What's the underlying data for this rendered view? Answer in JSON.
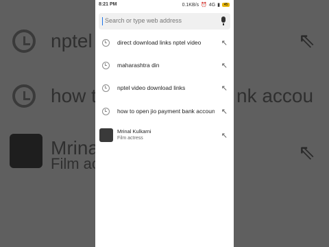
{
  "background": {
    "items": [
      "nptel vi",
      "how to",
      "nk accou",
      "Mrinal K",
      "Film act"
    ]
  },
  "status_bar": {
    "time": "8:21 PM",
    "speed": "0.1KB/s",
    "network": "4G",
    "battery": "45"
  },
  "search": {
    "placeholder": "Search or type web address"
  },
  "suggestions": [
    {
      "label": "direct download links nptel video",
      "icon": "history-icon"
    },
    {
      "label": "maharashtra din",
      "icon": "history-icon"
    },
    {
      "label": "nptel video download links",
      "icon": "history-icon"
    },
    {
      "label": "how to open jio payment bank account",
      "icon": "history-icon"
    }
  ],
  "entity": {
    "title": "Mrinal Kulkarni",
    "subtitle": "Film actress"
  },
  "colors": {
    "accent": "#1a73e8",
    "battery": "#e7b50a"
  }
}
